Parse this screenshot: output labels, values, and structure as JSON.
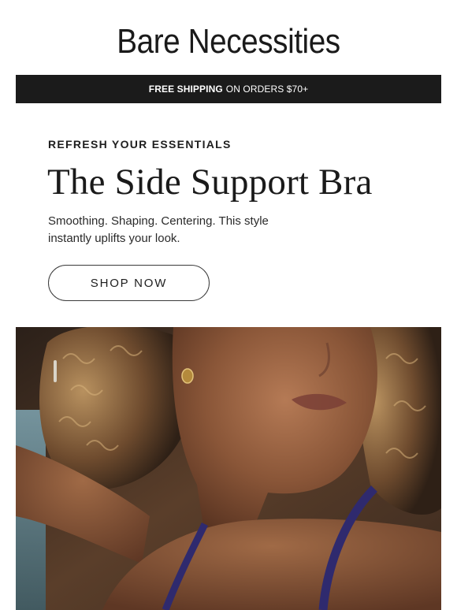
{
  "brand": {
    "name": "Bare Necessities"
  },
  "shipping_bar": {
    "strong": "FREE SHIPPING",
    "rest": "ON ORDERS $70+"
  },
  "promo": {
    "eyebrow": "REFRESH YOUR ESSENTIALS",
    "headline": "The Side Support Bra",
    "subcopy": "Smoothing. Shaping. Centering. This style instantly uplifts your look.",
    "cta_label": "SHOP NOW"
  },
  "colors": {
    "bar_background": "#1b1b1b",
    "text": "#1b1b1b",
    "bra_strap": "#2f2a6e"
  }
}
